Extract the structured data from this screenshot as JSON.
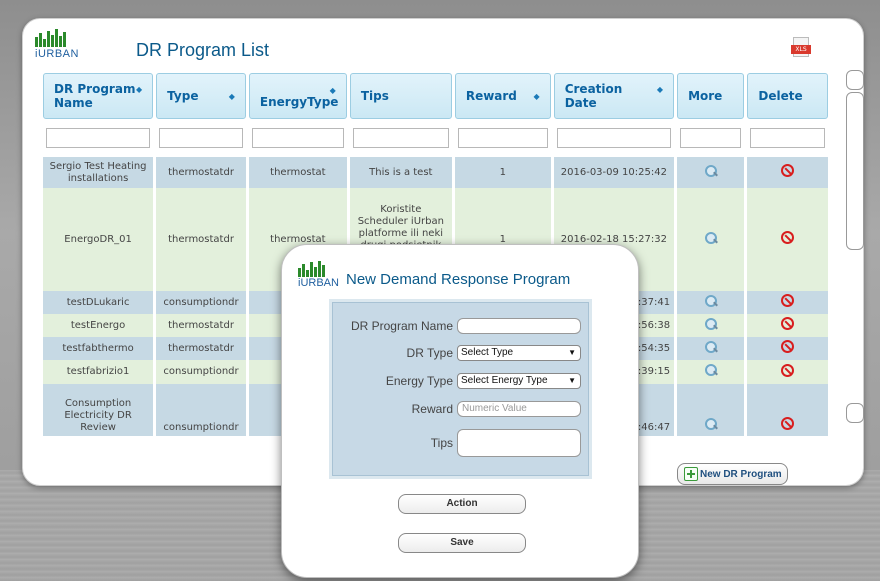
{
  "app": {
    "brand": "iURBAN",
    "list_title": "DR Program List",
    "xls_label": "XLS"
  },
  "table": {
    "headers": [
      "DR Program Name",
      "Type",
      "EnergyType",
      "Tips",
      "Reward",
      "Creation Date",
      "More",
      "Delete"
    ],
    "rows": [
      {
        "name": "Sergio Test Heating installations",
        "type": "thermostatdr",
        "energy": "thermostat",
        "tips": "This is a test",
        "reward": "1",
        "date": "2016-03-09 10:25:42"
      },
      {
        "name": "EnergoDR_01",
        "type": "thermostatdr",
        "energy": "thermostat",
        "tips": "Koristite Scheduler iUrban platforme ili neki drugi podsjetnik ukoliko bi bilo dodatno",
        "reward": "1",
        "date": "2016-02-18 15:27:32"
      },
      {
        "name": "testDLukaric",
        "type": "consumptiondr",
        "energy": "",
        "tips": "",
        "reward": "",
        "date": "14:37:41"
      },
      {
        "name": "testEnergo",
        "type": "thermostatdr",
        "energy": "",
        "tips": "",
        "reward": "",
        "date": "14:56:38"
      },
      {
        "name": "testfabthermo",
        "type": "thermostatdr",
        "energy": "",
        "tips": "",
        "reward": "",
        "date": "10:54:35"
      },
      {
        "name": "testfabrizio1",
        "type": "consumptiondr",
        "energy": "",
        "tips": "",
        "reward": "",
        "date": "12:39:15"
      },
      {
        "name": "Consumption Electricity DR Review",
        "type": "consumptiondr",
        "energy": "",
        "tips": "",
        "reward": "",
        "date": "16:46:47"
      }
    ]
  },
  "new_button": "New DR Program",
  "modal": {
    "brand": "iURBAN",
    "title": "New Demand Response Program",
    "fields": {
      "name_label": "DR Program Name",
      "type_label": "DR Type",
      "type_value": "Select Type",
      "energy_label": "Energy Type",
      "energy_value": "Select Energy Type",
      "reward_label": "Reward",
      "reward_placeholder": "Numeric Value",
      "tips_label": "Tips"
    },
    "action_button": "Action",
    "save_button": "Save"
  }
}
